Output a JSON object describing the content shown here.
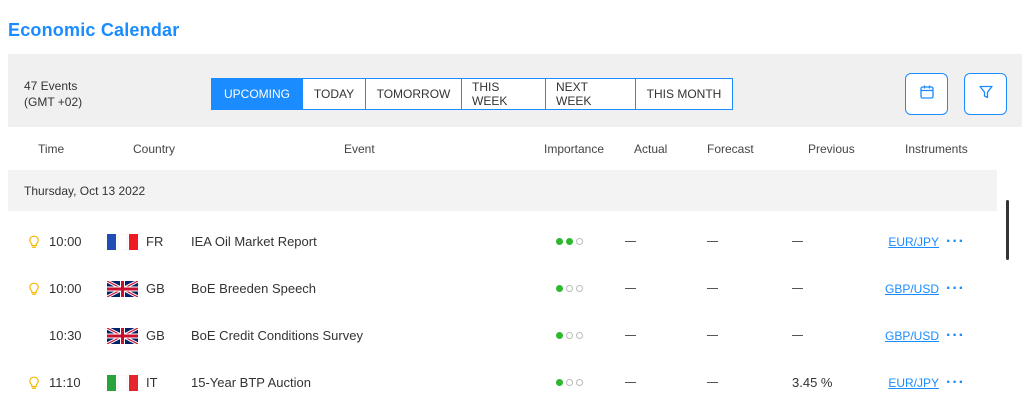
{
  "title": "Economic Calendar",
  "summary": {
    "events": "47 Events",
    "timezone": "(GMT +02)"
  },
  "tabs": {
    "upcoming": "UPCOMING",
    "today": "TODAY",
    "tomorrow": "TOMORROW",
    "this_week": "THIS WEEK",
    "next_week": "NEXT WEEK",
    "this_month": "THIS MONTH",
    "active": "UPCOMING"
  },
  "icons": {
    "calendar": "calendar-icon",
    "filter": "filter-icon",
    "bulb": "lightbulb-icon",
    "more": "more-icon"
  },
  "columns": {
    "time": "Time",
    "country": "Country",
    "event": "Event",
    "importance": "Importance",
    "actual": "Actual",
    "forecast": "Forecast",
    "previous": "Previous",
    "instruments": "Instruments"
  },
  "date_group": "Thursday, Oct 13 2022",
  "rows": [
    {
      "time": "10:00",
      "country": "FR",
      "event": "IEA Oil Market Report",
      "importance": 2,
      "actual": "",
      "forecast": "",
      "previous": "",
      "instrument": "EUR/JPY",
      "bulb": true
    },
    {
      "time": "10:00",
      "country": "GB",
      "event": "BoE Breeden Speech",
      "importance": 1,
      "actual": "",
      "forecast": "",
      "previous": "",
      "instrument": "GBP/USD",
      "bulb": true
    },
    {
      "time": "10:30",
      "country": "GB",
      "event": "BoE Credit Conditions Survey",
      "importance": 1,
      "actual": "",
      "forecast": "",
      "previous": "",
      "instrument": "GBP/USD",
      "bulb": false
    },
    {
      "time": "11:10",
      "country": "IT",
      "event": "15-Year BTP Auction",
      "importance": 1,
      "actual": "",
      "forecast": "",
      "previous": "3.45 %",
      "instrument": "EUR/JPY",
      "bulb": true
    }
  ],
  "colors": {
    "accent": "#1a8cff",
    "importance_on": "#2eb82e",
    "bulb": "#f5b800"
  }
}
